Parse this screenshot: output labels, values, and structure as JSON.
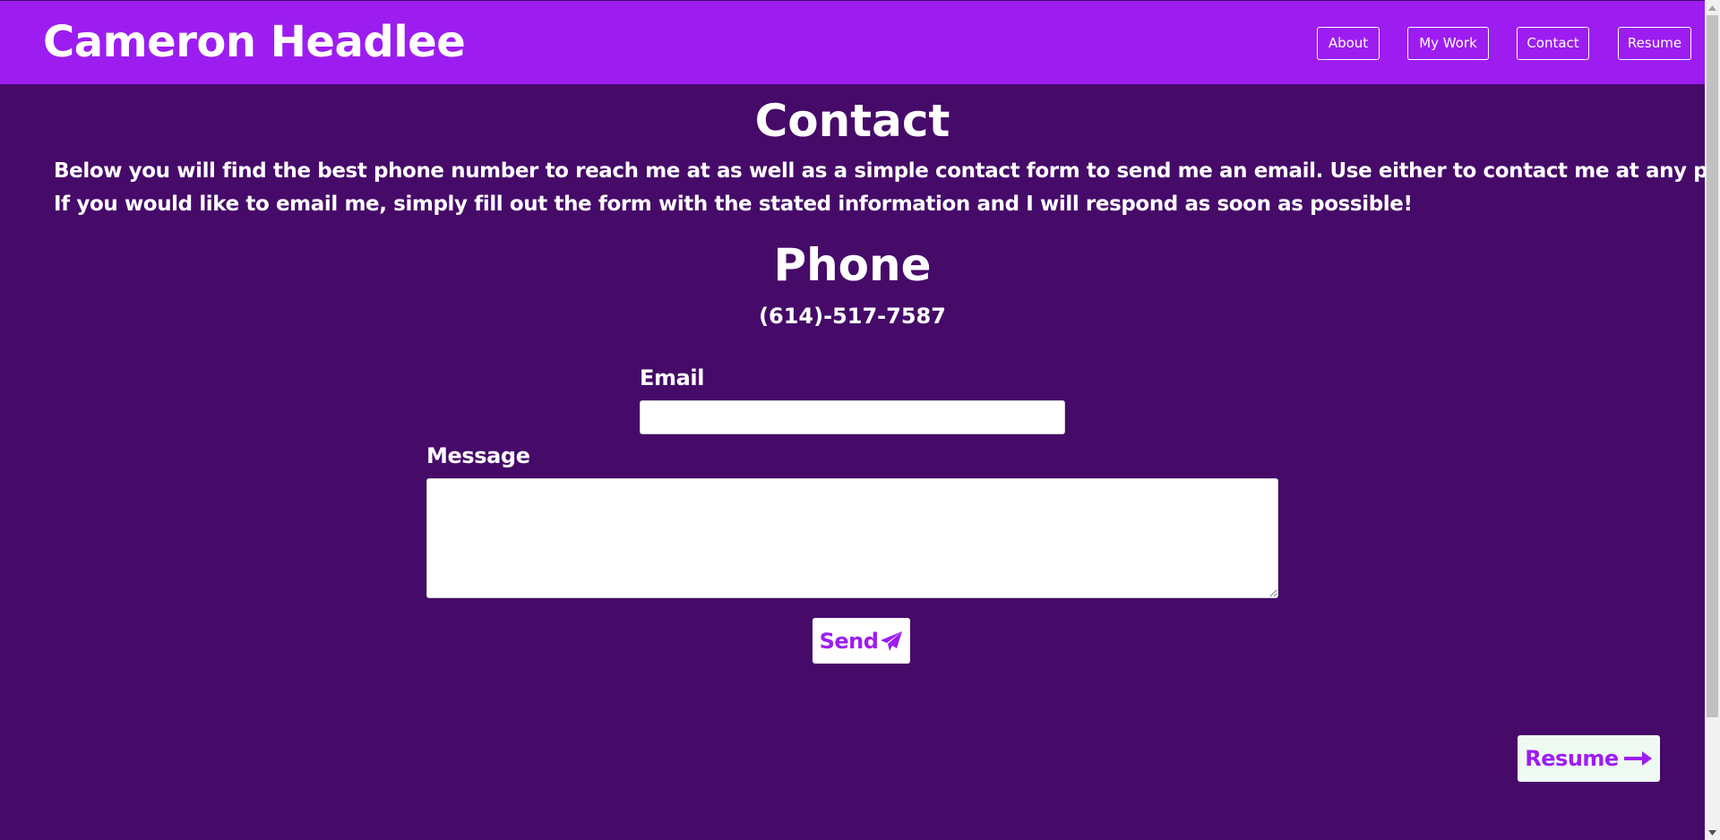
{
  "header": {
    "site_title": "Cameron Headlee",
    "nav": [
      {
        "label": "About"
      },
      {
        "label": "My Work"
      },
      {
        "label": "Contact"
      },
      {
        "label": "Resume"
      }
    ]
  },
  "main": {
    "heading": "Contact",
    "intro_lines": [
      "Below you will find the best phone number to reach me at as well as a simple contact form to send me an email. Use either to contact me at any point.",
      "If you would like to email me, simply fill out the form with the stated information and I will respond as soon as possible!"
    ],
    "phone_heading": "Phone",
    "phone_number": "(614)-517-7587"
  },
  "form": {
    "email_label": "Email",
    "email_value": "",
    "message_label": "Message",
    "message_value": "",
    "send_label": "Send",
    "send_icon": "paper-plane-icon"
  },
  "footer_nav": {
    "resume_label": "Resume",
    "resume_icon": "arrow-right-icon"
  },
  "colors": {
    "background": "#460a69",
    "header": "#9d1df1",
    "text": "#ffffff",
    "accent": "#9d1df1",
    "resume_button_bg": "#effaf3"
  }
}
